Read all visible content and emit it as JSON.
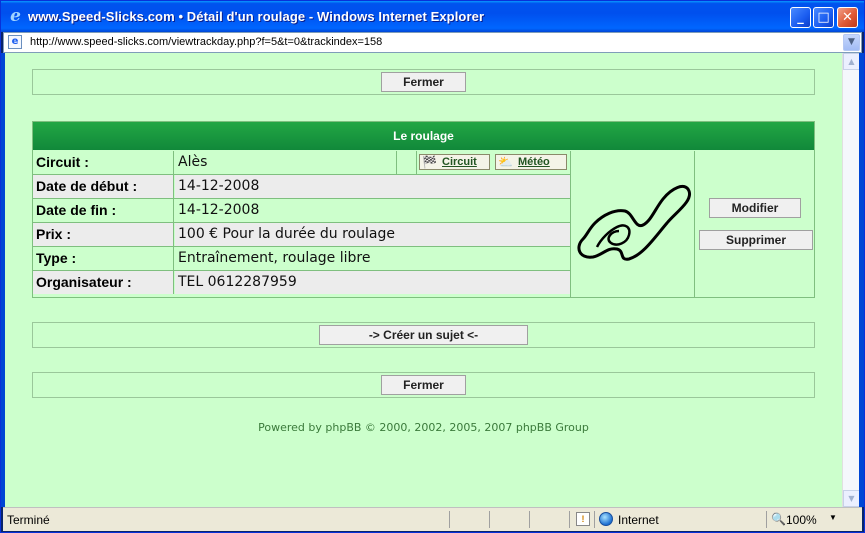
{
  "window": {
    "title": "www.Speed-Slicks.com • Détail d'un roulage - Windows Internet Explorer",
    "url": "http://www.speed-slicks.com/viewtrackday.php?f=5&t=0&trackindex=158"
  },
  "page": {
    "close_top_label": "Fermer",
    "section_title": "Le roulage",
    "rows": [
      {
        "label": "Circuit :",
        "value": "Alès"
      },
      {
        "label": "Date de début :",
        "value": "14-12-2008"
      },
      {
        "label": "Date de fin :",
        "value": "14-12-2008"
      },
      {
        "label": "Prix :",
        "value": "100 € Pour la durée du roulage"
      },
      {
        "label": "Type :",
        "value": "Entraînement, roulage libre"
      },
      {
        "label": "Organisateur :",
        "value": "TEL 0612287959"
      }
    ],
    "circuit_link_label": "Circuit",
    "meteo_link_label": "Météo",
    "modify_label": "Modifier",
    "delete_label": "Supprimer",
    "create_topic_label": "-> Créer un sujet <-",
    "close_bottom_label": "Fermer",
    "footer": "Powered by phpBB © 2000, 2002, 2005, 2007 phpBB Group"
  },
  "status": {
    "text": "Terminé",
    "zone": "Internet",
    "zoom": "100%"
  },
  "icons": {
    "browser": "ie-icon",
    "page": "page-icon",
    "circuit": "checkered-flag-icon",
    "meteo": "sun-cloud-icon",
    "zone": "globe-icon",
    "security": "security-warning-icon",
    "zoom": "magnifier-icon"
  },
  "colors": {
    "page_bg": "#ccffcc",
    "header_bg": "#11883a",
    "footer_text": "#3a7a3a"
  }
}
